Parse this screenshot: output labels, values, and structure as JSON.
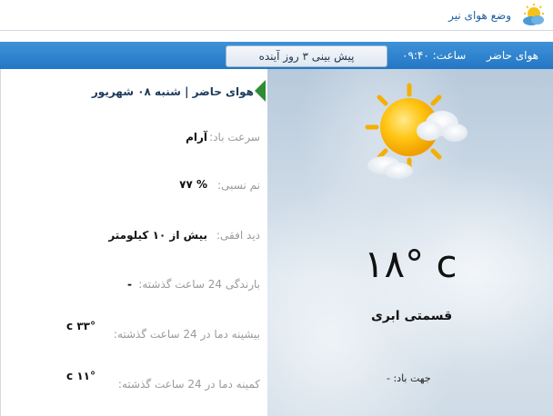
{
  "header": {
    "title": "وضع هوای نیر",
    "logo_icon": "sun-cloud-icon"
  },
  "tabs": {
    "current_label": "هوای حاضر",
    "time_label": "ساعت: ۰۹:۴۰",
    "forecast_label": "پیش بینی ۳ روز آینده"
  },
  "panel": {
    "heading": "هوای حاضر | شنبه ۰۸ شهریور",
    "rows": [
      {
        "label": "سرعت باد:",
        "value": "آرام"
      },
      {
        "label": "نم نسبی:",
        "value": "% ۷۷"
      },
      {
        "label": "دید افقی:",
        "value": "بیش از ۱۰ کیلومتر"
      },
      {
        "label": "بارندگی 24 ساعت گذشته:",
        "value": "-"
      },
      {
        "label": "بیشینه دما در 24 ساعت گذشته:",
        "value": "۳۳° c"
      },
      {
        "label": "کمینه دما در 24 ساعت گذشته:",
        "value": "۱۱° c"
      }
    ]
  },
  "weather": {
    "icon": "partly-cloudy-sun-icon",
    "temperature": "۱۸° c",
    "condition": "قسمتی ابری",
    "wind_direction": "جهت باد: -"
  },
  "colors": {
    "tabbar": "#2f86d0",
    "accent_arrow": "#2f8c34",
    "title_blue": "#1f5f9f"
  }
}
